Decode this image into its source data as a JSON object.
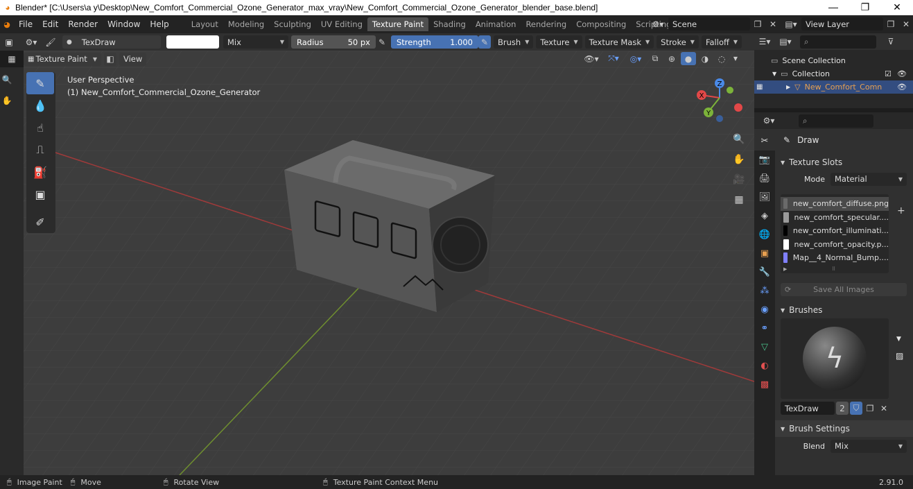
{
  "window": {
    "title": "Blender* [C:\\Users\\a y\\Desktop\\New_Comfort_Commercial_Ozone_Generator_max_vray\\New_Comfort_Commercial_Ozone_Generator_blender_base.blend]",
    "minimize": "—",
    "maximize": "❐",
    "close": "✕"
  },
  "menu": [
    "File",
    "Edit",
    "Render",
    "Window",
    "Help"
  ],
  "workspaces": [
    {
      "label": "Layout",
      "active": false
    },
    {
      "label": "Modeling",
      "active": false
    },
    {
      "label": "Sculpting",
      "active": false
    },
    {
      "label": "UV Editing",
      "active": false
    },
    {
      "label": "Texture Paint",
      "active": true
    },
    {
      "label": "Shading",
      "active": false
    },
    {
      "label": "Animation",
      "active": false
    },
    {
      "label": "Rendering",
      "active": false
    },
    {
      "label": "Compositing",
      "active": false
    },
    {
      "label": "Scripting",
      "active": false
    }
  ],
  "add_workspace": "+",
  "scene": {
    "label": "Scene"
  },
  "view_layer": {
    "label": "View Layer"
  },
  "tool_header": {
    "brush_name": "TexDraw",
    "blend_mode": "Mix",
    "radius_label": "Radius",
    "radius_value": "50 px",
    "strength_label": "Strength",
    "strength_value": "1.000",
    "menus": [
      "Brush",
      "Texture",
      "Texture Mask",
      "Stroke",
      "Falloff"
    ]
  },
  "viewport_header": {
    "mode": "Texture Paint",
    "view_menu": "View"
  },
  "viewport": {
    "perspective": "User Perspective",
    "object_label": "(1) New_Comfort_Commercial_Ozone_Generator",
    "gizmo": {
      "x": "X",
      "y": "Y",
      "z": "Z"
    },
    "colors": {
      "x_axis": "#e24848",
      "y_axis": "#7cb33a",
      "z_axis": "#4a8ae8",
      "grid_bg": "#3d3d3d"
    }
  },
  "tools": [
    {
      "name": "draw",
      "glyph": "✎",
      "active": true
    },
    {
      "name": "soften",
      "glyph": "💧",
      "active": false
    },
    {
      "name": "smear",
      "glyph": "☝",
      "active": false
    },
    {
      "name": "clone",
      "glyph": "⎍",
      "active": false
    },
    {
      "name": "fill",
      "glyph": "⛽",
      "active": false
    },
    {
      "name": "mask",
      "glyph": "▣",
      "active": false
    },
    {
      "name": "annotate",
      "glyph": "✐",
      "active": false
    }
  ],
  "outliner": {
    "scene_collection": "Scene Collection",
    "collection": "Collection",
    "object": "New_Comfort_Comn",
    "search_placeholder": ""
  },
  "properties": {
    "active_tool": "Draw",
    "texture_slots": {
      "title": "Texture Slots",
      "mode_label": "Mode",
      "mode_value": "Material",
      "slots": [
        {
          "name": "new_comfort_diffuse.png",
          "color": "#6a6a6a",
          "selected": true
        },
        {
          "name": "new_comfort_specular....",
          "color": "#9a9a9a",
          "selected": false
        },
        {
          "name": "new_comfort_illuminati...",
          "color": "#000000",
          "selected": false
        },
        {
          "name": "new_comfort_opacity.p...",
          "color": "#ffffff",
          "selected": false
        },
        {
          "name": "Map__4_Normal_Bump....",
          "color": "#8080ff",
          "selected": false
        }
      ],
      "save_all": "Save All Images"
    },
    "brushes": {
      "title": "Brushes",
      "brush_name": "TexDraw",
      "users": "2"
    },
    "brush_settings": {
      "title": "Brush Settings",
      "blend_label": "Blend",
      "blend_value": "Mix"
    }
  },
  "statusbar": {
    "items": [
      "Image Paint",
      "Move",
      "Rotate View",
      "Texture Paint Context Menu"
    ],
    "version": "2.91.0"
  }
}
